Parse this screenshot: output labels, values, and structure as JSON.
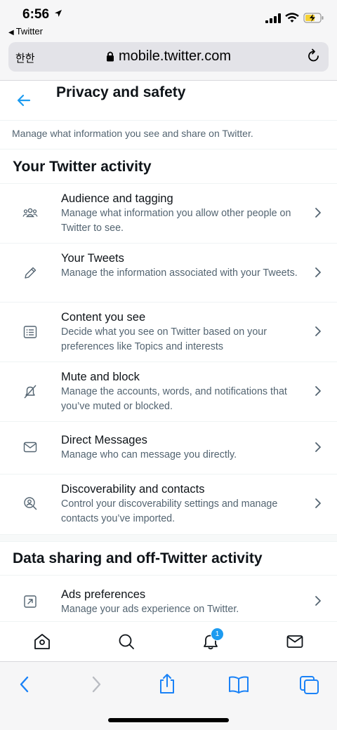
{
  "status_bar": {
    "time": "6:56",
    "back_app": "Twitter"
  },
  "url_bar": {
    "aa_label": "한한",
    "url": "mobile.twitter.com"
  },
  "header": {
    "title": "Privacy and safety"
  },
  "subtitle": "Manage what information you see and share on Twitter.",
  "sections": [
    {
      "title": "Your Twitter activity"
    },
    {
      "title": "Data sharing and off-Twitter activity"
    }
  ],
  "items": [
    {
      "title": "Audience and tagging",
      "desc": "Manage what information you allow other people on Twitter to see.",
      "icon": "people-icon"
    },
    {
      "title": "Your Tweets",
      "desc": "Manage the information associated with your Tweets.",
      "icon": "pencil-icon"
    },
    {
      "title": "Content you see",
      "desc": "Decide what you see on Twitter based on your preferences like Topics and interests",
      "icon": "list-icon"
    },
    {
      "title": "Mute and block",
      "desc": "Manage the accounts, words, and notifications that you’ve muted or blocked.",
      "icon": "muted-bell-icon"
    },
    {
      "title": "Direct Messages",
      "desc": "Manage who can message you directly.",
      "icon": "envelope-icon"
    },
    {
      "title": "Discoverability and contacts",
      "desc": "Control your discoverability settings and manage contacts you’ve imported.",
      "icon": "person-search-icon"
    },
    {
      "title": "Ads preferences",
      "desc": "Manage your ads experience on Twitter.",
      "icon": "external-arrow-icon"
    }
  ],
  "bottom_nav": {
    "notification_count": "1"
  },
  "colors": {
    "accent": "#1d9bf0",
    "safari_blue": "#1a82f7",
    "secondary_text": "#536471"
  }
}
